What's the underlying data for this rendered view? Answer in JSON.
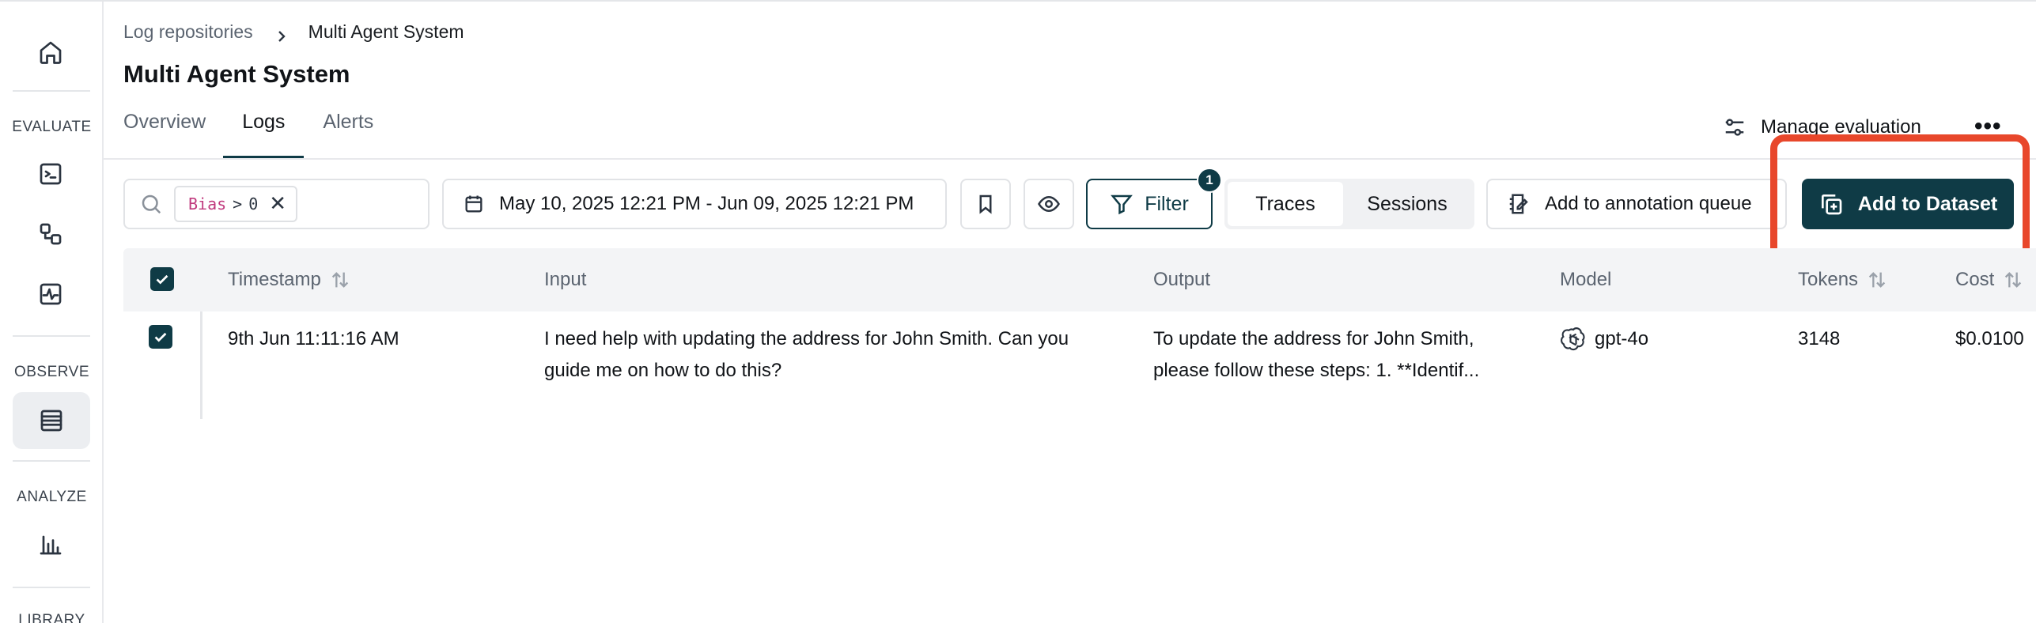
{
  "sidebar": {
    "sections": [
      {
        "label": "EVALUATE",
        "items": [
          "terminal-icon",
          "workflow-icon",
          "activity-icon"
        ]
      },
      {
        "label": "OBSERVE",
        "items": [
          "logs-table-icon"
        ]
      },
      {
        "label": "ANALYZE",
        "items": [
          "bar-chart-icon"
        ]
      },
      {
        "label": "LIBRARY",
        "items": []
      }
    ],
    "home_icon": "home-icon",
    "evaluate_label": "EVALUATE",
    "observe_label": "OBSERVE",
    "analyze_label": "ANALYZE",
    "library_label": "LIBRARY"
  },
  "header": {
    "breadcrumb_parent": "Log repositories",
    "breadcrumb_current": "Multi Agent System",
    "title": "Multi Agent System",
    "tabs": [
      {
        "label": "Overview",
        "active": false
      },
      {
        "label": "Logs",
        "active": true
      },
      {
        "label": "Alerts",
        "active": false
      }
    ],
    "manage_evaluation": "Manage evaluation",
    "more": "•••"
  },
  "toolbar": {
    "filter_chip": {
      "key": "Bias",
      "operator": ">",
      "value": "0"
    },
    "date_range": "May 10, 2025 12:21 PM - Jun 09, 2025 12:21 PM",
    "filter_label": "Filter",
    "filter_count": "1",
    "view_toggle": [
      {
        "label": "Traces",
        "active": true
      },
      {
        "label": "Sessions",
        "active": false
      }
    ],
    "annotation_queue": "Add to annotation queue",
    "add_dataset": "Add to Dataset"
  },
  "table": {
    "columns": [
      "Timestamp",
      "Input",
      "Output",
      "Model",
      "Tokens",
      "Cost"
    ],
    "sortable": [
      "Timestamp",
      "Tokens",
      "Cost"
    ],
    "rows": [
      {
        "selected": true,
        "timestamp": "9th Jun 11:11:16 AM",
        "input_line1": "I need help with updating the address for John Smith. Can you",
        "input_line2": "guide me on how to do this?",
        "output_line1": "To update the address for John Smith,",
        "output_line2": "please follow these steps: 1. **Identif...",
        "model": "gpt-4o",
        "tokens": "3148",
        "cost": "$0.0100"
      }
    ]
  },
  "colors": {
    "primary": "#0f3b46",
    "highlight": "#e8472b",
    "chip_key": "#c0397d"
  }
}
